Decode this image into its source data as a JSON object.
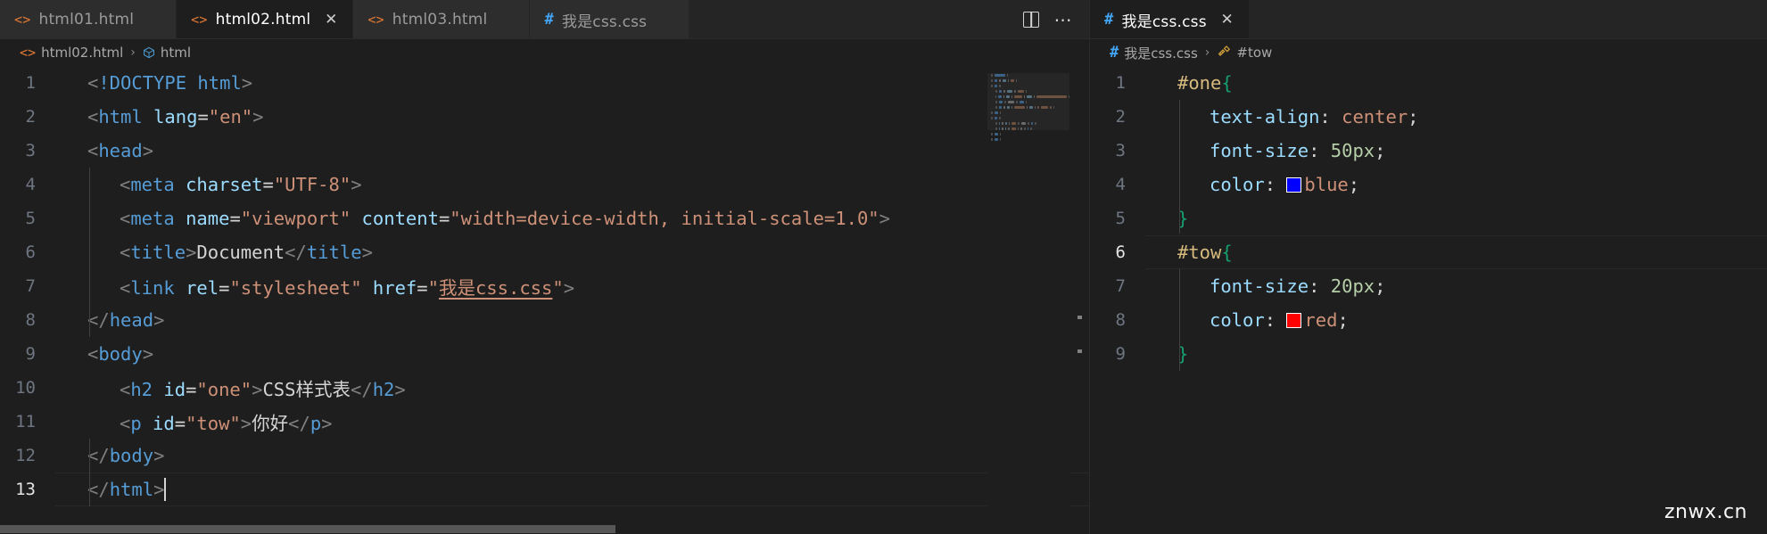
{
  "window": {
    "theme": "dark-plus",
    "background": "#1e1e1e",
    "watermark": "znwx.cn"
  },
  "left_group": {
    "tabs": [
      {
        "label": "html01.html",
        "icon": "html-file-icon",
        "icon_glyph": "<>",
        "active": false,
        "dirty": false
      },
      {
        "label": "html02.html",
        "icon": "html-file-icon",
        "icon_glyph": "<>",
        "active": true,
        "dirty": false
      },
      {
        "label": "html03.html",
        "icon": "html-file-icon",
        "icon_glyph": "<>",
        "active": false,
        "dirty": false
      },
      {
        "label": "我是css.css",
        "icon": "css-file-icon",
        "icon_glyph": "#",
        "active": false,
        "dirty": false
      }
    ],
    "tab_close_glyph": "✕",
    "actions": [
      {
        "name": "split-editor-icon",
        "label": "Split Editor"
      },
      {
        "name": "more-actions-icon",
        "label": "···"
      }
    ],
    "breadcrumb": [
      {
        "label": "html02.html",
        "icon": "html-file-icon"
      },
      {
        "label": "html",
        "icon": "symbol-tag-icon"
      }
    ],
    "breadcrumb_separator": "›",
    "language": "html",
    "active_line": 13,
    "code_lines": [
      {
        "n": 1,
        "indent": 0,
        "tokens": [
          {
            "t": "br",
            "v": "<"
          },
          {
            "t": "doct",
            "v": "!DOCTYPE html"
          },
          {
            "t": "br",
            "v": ">"
          }
        ]
      },
      {
        "n": 2,
        "indent": 0,
        "tokens": [
          {
            "t": "br",
            "v": "<"
          },
          {
            "t": "tag",
            "v": "html"
          },
          {
            "t": "txt",
            "v": " "
          },
          {
            "t": "attr",
            "v": "lang"
          },
          {
            "t": "eq",
            "v": "="
          },
          {
            "t": "str",
            "v": "\"en\""
          },
          {
            "t": "br",
            "v": ">"
          }
        ]
      },
      {
        "n": 3,
        "indent": 0,
        "tokens": [
          {
            "t": "br",
            "v": "<"
          },
          {
            "t": "tag",
            "v": "head"
          },
          {
            "t": "br",
            "v": ">"
          }
        ]
      },
      {
        "n": 4,
        "indent": 1,
        "tokens": [
          {
            "t": "br",
            "v": "<"
          },
          {
            "t": "tag",
            "v": "meta"
          },
          {
            "t": "txt",
            "v": " "
          },
          {
            "t": "attr",
            "v": "charset"
          },
          {
            "t": "eq",
            "v": "="
          },
          {
            "t": "str",
            "v": "\"UTF-8\""
          },
          {
            "t": "br",
            "v": ">"
          }
        ]
      },
      {
        "n": 5,
        "indent": 1,
        "tokens": [
          {
            "t": "br",
            "v": "<"
          },
          {
            "t": "tag",
            "v": "meta"
          },
          {
            "t": "txt",
            "v": " "
          },
          {
            "t": "attr",
            "v": "name"
          },
          {
            "t": "eq",
            "v": "="
          },
          {
            "t": "str",
            "v": "\"viewport\""
          },
          {
            "t": "txt",
            "v": " "
          },
          {
            "t": "attr",
            "v": "content"
          },
          {
            "t": "eq",
            "v": "="
          },
          {
            "t": "str",
            "v": "\"width=device-width, initial-scale=1.0\""
          },
          {
            "t": "br",
            "v": ">"
          }
        ]
      },
      {
        "n": 6,
        "indent": 1,
        "tokens": [
          {
            "t": "br",
            "v": "<"
          },
          {
            "t": "tag",
            "v": "title"
          },
          {
            "t": "br",
            "v": ">"
          },
          {
            "t": "txt",
            "v": "Document"
          },
          {
            "t": "br",
            "v": "</"
          },
          {
            "t": "tag",
            "v": "title"
          },
          {
            "t": "br",
            "v": ">"
          }
        ]
      },
      {
        "n": 7,
        "indent": 1,
        "tokens": [
          {
            "t": "br",
            "v": "<"
          },
          {
            "t": "tag",
            "v": "link"
          },
          {
            "t": "txt",
            "v": " "
          },
          {
            "t": "attr",
            "v": "rel"
          },
          {
            "t": "eq",
            "v": "="
          },
          {
            "t": "str",
            "v": "\"stylesheet\""
          },
          {
            "t": "txt",
            "v": " "
          },
          {
            "t": "attr",
            "v": "href"
          },
          {
            "t": "eq",
            "v": "="
          },
          {
            "t": "str",
            "v": "\""
          },
          {
            "t": "link",
            "v": "我是css.css"
          },
          {
            "t": "str",
            "v": "\""
          },
          {
            "t": "br",
            "v": ">"
          }
        ]
      },
      {
        "n": 8,
        "indent": 0,
        "tokens": [
          {
            "t": "br",
            "v": "</"
          },
          {
            "t": "tag",
            "v": "head"
          },
          {
            "t": "br",
            "v": ">"
          }
        ]
      },
      {
        "n": 9,
        "indent": 0,
        "tokens": [
          {
            "t": "br",
            "v": "<"
          },
          {
            "t": "tag",
            "v": "body"
          },
          {
            "t": "br",
            "v": ">"
          }
        ]
      },
      {
        "n": 10,
        "indent": 1,
        "tokens": [
          {
            "t": "br",
            "v": "<"
          },
          {
            "t": "tag",
            "v": "h2"
          },
          {
            "t": "txt",
            "v": " "
          },
          {
            "t": "attr",
            "v": "id"
          },
          {
            "t": "eq",
            "v": "="
          },
          {
            "t": "str",
            "v": "\"one\""
          },
          {
            "t": "br",
            "v": ">"
          },
          {
            "t": "txt",
            "v": "CSS样式表"
          },
          {
            "t": "br",
            "v": "</"
          },
          {
            "t": "tag",
            "v": "h2"
          },
          {
            "t": "br",
            "v": ">"
          }
        ]
      },
      {
        "n": 11,
        "indent": 1,
        "tokens": [
          {
            "t": "br",
            "v": "<"
          },
          {
            "t": "tag",
            "v": "p"
          },
          {
            "t": "txt",
            "v": " "
          },
          {
            "t": "attr",
            "v": "id"
          },
          {
            "t": "eq",
            "v": "="
          },
          {
            "t": "str",
            "v": "\"tow\""
          },
          {
            "t": "br",
            "v": ">"
          },
          {
            "t": "txt",
            "v": "你好"
          },
          {
            "t": "br",
            "v": "</"
          },
          {
            "t": "tag",
            "v": "p"
          },
          {
            "t": "br",
            "v": ">"
          }
        ]
      },
      {
        "n": 12,
        "indent": 0,
        "tokens": [
          {
            "t": "br",
            "v": "</"
          },
          {
            "t": "tag",
            "v": "body"
          },
          {
            "t": "br",
            "v": ">"
          }
        ]
      },
      {
        "n": 13,
        "indent": 0,
        "tokens": [
          {
            "t": "br",
            "v": "</"
          },
          {
            "t": "tag",
            "v": "html"
          },
          {
            "t": "br",
            "v": ">"
          },
          {
            "t": "caret",
            "v": ""
          }
        ]
      }
    ]
  },
  "right_group": {
    "tabs": [
      {
        "label": "我是css.css",
        "icon": "css-file-icon",
        "icon_glyph": "#",
        "active": true,
        "dirty": false
      }
    ],
    "tab_close_glyph": "✕",
    "breadcrumb": [
      {
        "label": "我是css.css",
        "icon": "css-file-icon"
      },
      {
        "label": "#tow",
        "icon": "symbol-ruler-icon"
      }
    ],
    "breadcrumb_separator": "›",
    "language": "css",
    "active_line": 6,
    "code_lines": [
      {
        "n": 1,
        "indent": 0,
        "tokens": [
          {
            "t": "sel",
            "v": "#one"
          },
          {
            "t": "brace",
            "v": "{"
          }
        ]
      },
      {
        "n": 2,
        "indent": 1,
        "tokens": [
          {
            "t": "prop",
            "v": "text-align"
          },
          {
            "t": "txt",
            "v": ": "
          },
          {
            "t": "str",
            "v": "center"
          },
          {
            "t": "txt",
            "v": ";"
          }
        ]
      },
      {
        "n": 3,
        "indent": 1,
        "tokens": [
          {
            "t": "prop",
            "v": "font-size"
          },
          {
            "t": "txt",
            "v": ": "
          },
          {
            "t": "num",
            "v": "50px"
          },
          {
            "t": "txt",
            "v": ";"
          }
        ]
      },
      {
        "n": 4,
        "indent": 1,
        "tokens": [
          {
            "t": "prop",
            "v": "color"
          },
          {
            "t": "txt",
            "v": ": "
          },
          {
            "t": "swatch",
            "v": "#0000ff"
          },
          {
            "t": "str",
            "v": "blue"
          },
          {
            "t": "txt",
            "v": ";"
          }
        ]
      },
      {
        "n": 5,
        "indent": 0,
        "tokens": [
          {
            "t": "brace",
            "v": "}"
          }
        ]
      },
      {
        "n": 6,
        "indent": 0,
        "tokens": [
          {
            "t": "sel",
            "v": "#tow"
          },
          {
            "t": "brace",
            "v": "{"
          }
        ]
      },
      {
        "n": 7,
        "indent": 1,
        "tokens": [
          {
            "t": "prop",
            "v": "font-size"
          },
          {
            "t": "txt",
            "v": ": "
          },
          {
            "t": "num",
            "v": "20px"
          },
          {
            "t": "txt",
            "v": ";"
          }
        ]
      },
      {
        "n": 8,
        "indent": 1,
        "tokens": [
          {
            "t": "prop",
            "v": "color"
          },
          {
            "t": "txt",
            "v": ": "
          },
          {
            "t": "swatch",
            "v": "#ff0000"
          },
          {
            "t": "str",
            "v": "red"
          },
          {
            "t": "txt",
            "v": ";"
          }
        ]
      },
      {
        "n": 9,
        "indent": 0,
        "tokens": [
          {
            "t": "brace",
            "v": "}"
          }
        ]
      }
    ]
  },
  "colors": {
    "tag": "#569cd6",
    "attribute": "#9cdcfe",
    "string": "#ce9178",
    "text": "#d4d4d4",
    "bracket": "#808080",
    "selector": "#d7ba7d",
    "number": "#b5cea8",
    "brace": "#179e6f",
    "line_number": "#6e7681",
    "editor_bg": "#1e1e1e",
    "tabbar_bg": "#252526",
    "inactive_tab_bg": "#2d2d2d"
  }
}
